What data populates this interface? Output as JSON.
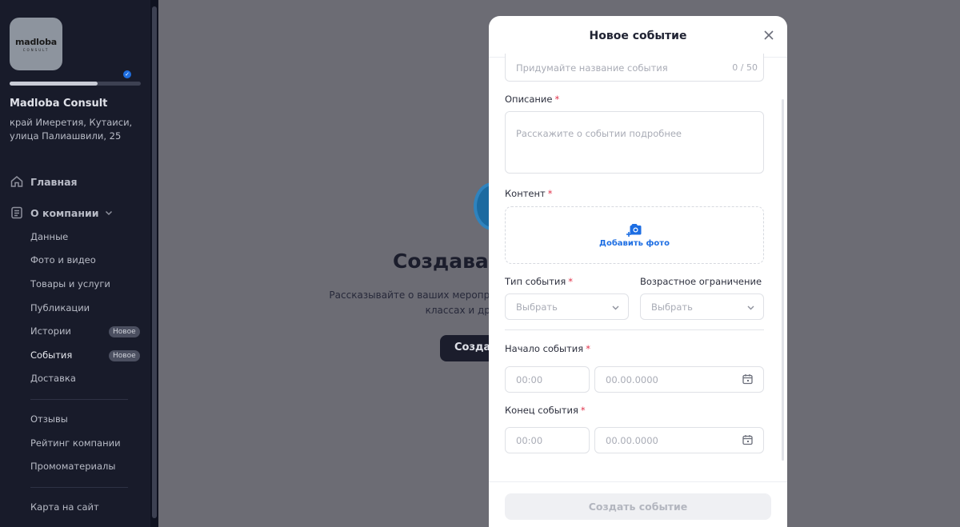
{
  "sidebar": {
    "logo_text": "madloba",
    "logo_sub": "CONSULT",
    "progress_fraction": 0.67,
    "company_name": "Madloba Consult",
    "company_address": "край Имеретия, Кутаиси, улица Палиашвили, 25",
    "nav": {
      "home": "Главная",
      "about": "О компании",
      "data": "Данные",
      "photo_video": "Фото и видео",
      "goods_services": "Товары и услуги",
      "publications": "Публикации",
      "stories": "Истории",
      "events": "События",
      "delivery": "Доставка",
      "reviews": "Отзывы",
      "rating": "Рейтинг компании",
      "promo": "Промоматериалы",
      "site_map": "Карта на сайт",
      "badge_new": "Новое"
    }
  },
  "background": {
    "heading": "Создавай",
    "text_line1": "Рассказывайте о ваших меропри",
    "text_line2": "классах и дру",
    "button": "Создат"
  },
  "modal": {
    "title": "Новое событие",
    "name_placeholder": "Придумайте название события",
    "name_counter": "0 / 50",
    "description_label": "Описание",
    "description_placeholder": "Расскажите о событии подробнее",
    "content_label": "Контент",
    "add_photo": "Добавить фото",
    "event_type_label": "Тип события",
    "event_type_value": "Выбрать",
    "age_label": "Возрастное ограничение",
    "age_value": "Выбрать",
    "start_label": "Начало события",
    "end_label": "Конец события",
    "time_placeholder": "00:00",
    "date_placeholder": "00.00.0000",
    "required_mark": "*",
    "submit": "Создать событие"
  },
  "colors": {
    "sidebar_bg": "#181b2a",
    "overlay": "#6c6c74",
    "accent": "#1d6ee3",
    "required": "#e0334b"
  }
}
